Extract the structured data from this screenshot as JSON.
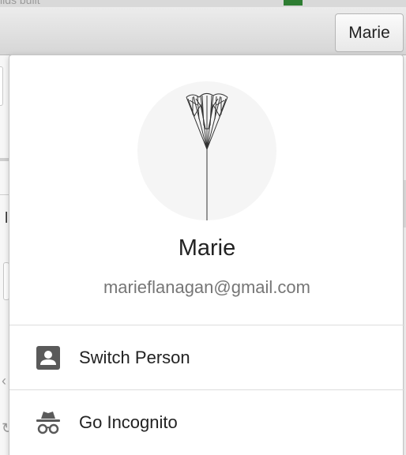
{
  "toolbar": {
    "profile_button_label": "Marie",
    "top_strip_text": "ilds built"
  },
  "profile_popup": {
    "name": "Marie",
    "email": "marieflanagan@gmail.com",
    "avatar_icon": "dandelion-tree-avatar-icon",
    "menu": [
      {
        "label": "Switch Person",
        "icon": "person-card-icon"
      },
      {
        "label": "Go Incognito",
        "icon": "incognito-icon"
      }
    ]
  },
  "colors": {
    "popup_bg": "#ffffff",
    "text_primary": "#222222",
    "text_secondary": "#767676",
    "icon_gray": "#5a5a5a"
  }
}
